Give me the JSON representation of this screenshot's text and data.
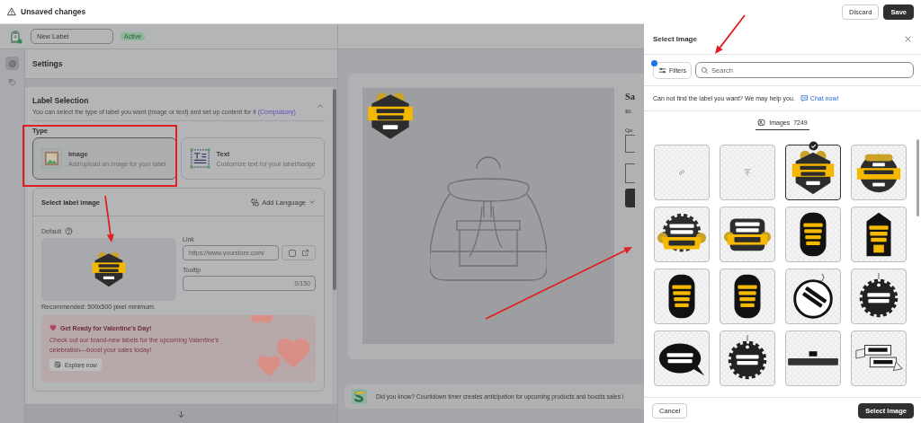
{
  "top_bar": {
    "title": "Unsaved changes",
    "buttons": [
      {
        "label": "Discard",
        "kind": "secondary"
      },
      {
        "label": "Save",
        "kind": "primary"
      }
    ]
  },
  "app_header": {
    "label_name": "New Label",
    "status": "Active"
  },
  "nav": [
    {
      "kind": "settings",
      "selected": true
    },
    {
      "kind": "tag",
      "selected": false
    }
  ],
  "settings": {
    "title": "Settings",
    "section": {
      "title": "Label Selection",
      "description": "You can select the type of label you want (image or text) and set up content for it",
      "required_note": "(Compulsory)",
      "expanded": true,
      "type_label": "Type",
      "types": [
        {
          "kind": "image",
          "title": "Image",
          "description": "Add/upload an image for your label",
          "selected": true
        },
        {
          "kind": "text",
          "title": "Text",
          "description": "Customize text for your label/badge",
          "selected": false
        }
      ],
      "image_card": {
        "title": "Select label image",
        "language_button": "Add Language",
        "default_label": "Default",
        "link_label": "Link",
        "link_placeholder": "https://www.yourstore.com/",
        "link_new_tab": false,
        "tooltip_label": "Tooltip",
        "tooltip_counter": "0/150",
        "hint": "Recommended: 500x500 pixel minimum.",
        "promo": {
          "title": "Get Ready for Valentine's Day!",
          "body": "Check out our brand-new labels for the upcoming Valentine's celebration—boost your sales today!",
          "button": "Explore now"
        }
      }
    }
  },
  "preview": {
    "product_title": "Sa",
    "price": "$0.",
    "quantity_label": "Qu",
    "tip": "Did you know? Countdown timer creates anticipation for upcoming products and boosts sales i"
  },
  "drawer": {
    "title": "Select Image",
    "filters_label": "Filters",
    "search_placeholder": "Search",
    "help_text": "Can not find the label you want? We may help you.",
    "chat_link": "Chat now!",
    "tabs": [
      {
        "label": "Images",
        "count": "7249",
        "selected": true
      }
    ],
    "tiles": [
      {
        "kind": "link",
        "selected": false
      },
      {
        "kind": "upload",
        "selected": false
      },
      {
        "kind": "shield",
        "selected": true
      },
      {
        "kind": "round",
        "selected": false
      },
      {
        "kind": "seal",
        "selected": false
      },
      {
        "kind": "plaque",
        "selected": false
      },
      {
        "kind": "capsule",
        "selected": false
      },
      {
        "kind": "tag",
        "selected": false
      },
      {
        "kind": "capsule",
        "selected": false
      },
      {
        "kind": "capsule",
        "selected": false
      },
      {
        "kind": "ring",
        "selected": false
      },
      {
        "kind": "scallop",
        "selected": false
      },
      {
        "kind": "bubble",
        "selected": false
      },
      {
        "kind": "scallop",
        "selected": false
      },
      {
        "kind": "strip",
        "selected": false
      },
      {
        "kind": "ribbon",
        "selected": false
      }
    ],
    "cancel_button": "Cancel",
    "confirm_button": "Select Image"
  }
}
